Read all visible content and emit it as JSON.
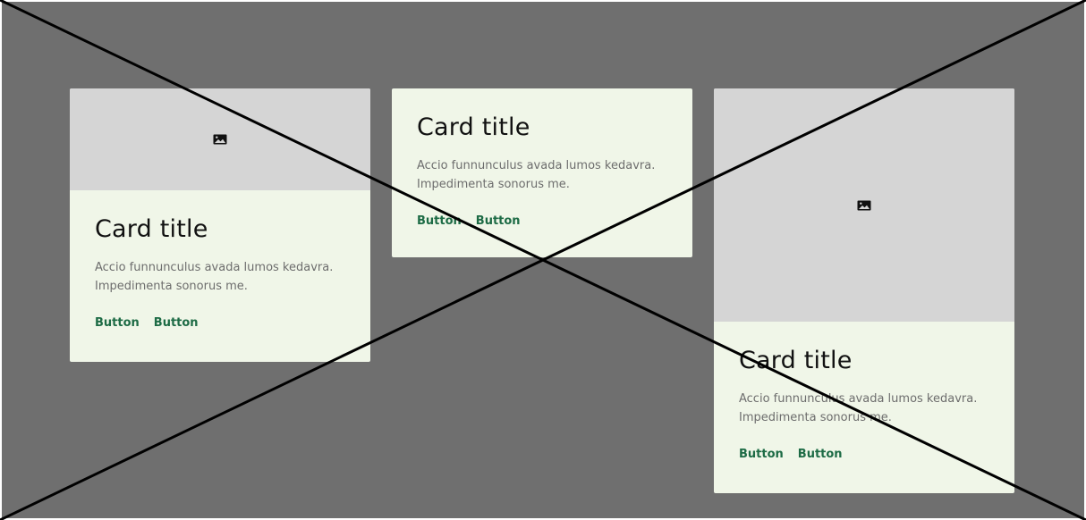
{
  "cards": [
    {
      "title": "Card title",
      "body_line1": "Accio funnunculus avada lumos kedavra.",
      "body_line2": "Impedimenta sonorus me.",
      "button1": "Button",
      "button2": "Button",
      "media_icon": "image-icon"
    },
    {
      "title": "Card title",
      "body_line1": "Accio funnunculus avada lumos kedavra.",
      "body_line2": "Impedimenta sonorus me.",
      "button1": "Button",
      "button2": "Button"
    },
    {
      "title": "Card title",
      "body_line1": "Accio funnunculus avada lumos kedavra.",
      "body_line2": "Impedimenta sonorus me.",
      "button1": "Button",
      "button2": "Button",
      "media_icon": "image-icon"
    }
  ],
  "colors": {
    "background": "#6f6f6f",
    "card": "#f0f6e8",
    "media": "#d5d5d5",
    "title": "#111111",
    "body": "#6d6d6d",
    "button": "#1d6b45",
    "diagonal": "#000000"
  }
}
